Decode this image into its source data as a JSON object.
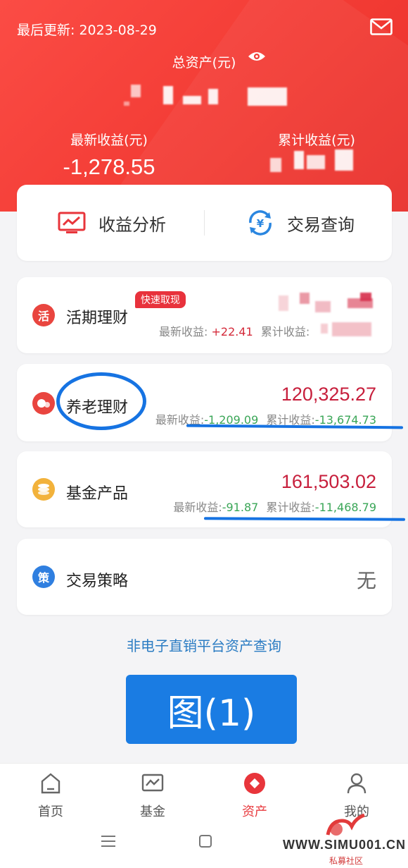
{
  "header": {
    "updated": "最后更新: 2023-08-29",
    "total_label": "总资产(元)",
    "latest_label": "最新收益(元)",
    "latest_value": "-1,278.55",
    "cumulative_label": "累计收益(元)"
  },
  "quick_actions": [
    {
      "label": "收益分析",
      "icon": "chart-icon"
    },
    {
      "label": "交易查询",
      "icon": "yen-exchange-icon"
    }
  ],
  "products": [
    {
      "badge": "活",
      "title": "活期理财",
      "tag": "快速取现",
      "latest_label": "最新收益:",
      "latest": "+22.41",
      "cum_label": "累计收益:"
    },
    {
      "title": "养老理财",
      "amount": "120,325.27",
      "latest_label": "最新收益:",
      "latest": "-1,209.09",
      "cum_label": "累计收益:",
      "cum": "-13,674.73"
    },
    {
      "title": "基金产品",
      "amount": "161,503.02",
      "latest_label": "最新收益:",
      "latest": "-91.87",
      "cum_label": "累计收益:",
      "cum": "-11,468.79"
    },
    {
      "badge": "策",
      "title": "交易策略",
      "amount": "无"
    }
  ],
  "link": "非电子直销平台资产查询",
  "caption_button": "图(1)",
  "nav": [
    {
      "label": "首页",
      "icon": "home-icon"
    },
    {
      "label": "基金",
      "icon": "fund-chart-icon"
    },
    {
      "label": "资产",
      "icon": "assets-icon",
      "active": true
    },
    {
      "label": "我的",
      "icon": "person-icon"
    }
  ],
  "watermark": {
    "site": "WWW.SIMU001.CN",
    "cn": "私募社区"
  },
  "colors": {
    "header_red": "#f23a33",
    "amount_red": "#c71f3c",
    "green": "#3aa657",
    "blue": "#1a7ce3"
  }
}
